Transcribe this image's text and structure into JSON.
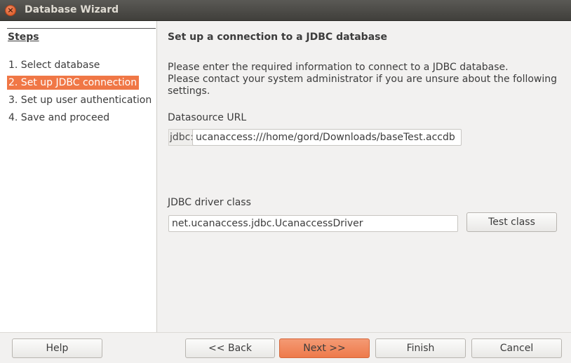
{
  "window": {
    "title": "Database Wizard"
  },
  "sidebar": {
    "heading": "Steps",
    "steps": [
      {
        "label": "1. Select database",
        "active": false
      },
      {
        "label": "2. Set up JDBC connection",
        "active": true
      },
      {
        "label": "3. Set up user authentication",
        "active": false
      },
      {
        "label": "4. Save and proceed",
        "active": false
      }
    ]
  },
  "main": {
    "title": "Set up a connection to a JDBC database",
    "info_line1": "Please enter the required information to connect to a JDBC database.",
    "info_line2": "Please contact your system administrator if you are unsure about the following settings.",
    "datasource": {
      "label": "Datasource URL",
      "prefix": "jdbc:",
      "value": "ucanaccess:///home/gord/Downloads/baseTest.accdb"
    },
    "driver": {
      "label": "JDBC driver class",
      "value": "net.ucanaccess.jdbc.UcanaccessDriver",
      "test_label": "Test class"
    }
  },
  "footer": {
    "help": "Help",
    "back": "<< Back",
    "next": "Next >>",
    "finish": "Finish",
    "cancel": "Cancel"
  },
  "colors": {
    "accent": "#f07746",
    "titlebar": "#403f3b"
  }
}
